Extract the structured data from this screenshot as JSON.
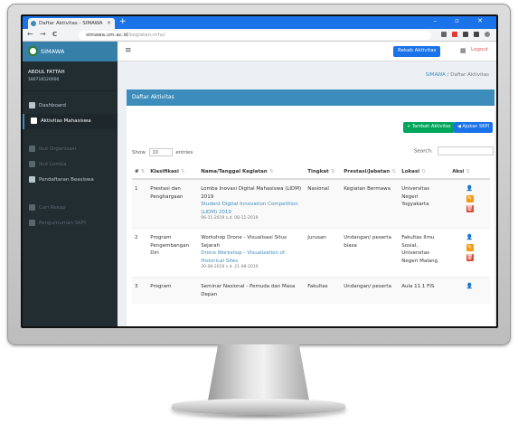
{
  "browser": {
    "tab_title": "Daftar Aktivitas - SIMAWA",
    "tab_close": "×",
    "new_tab": "+",
    "url_host": "simawa.um.ac.id",
    "url_path": "/kegiatan-mhs/",
    "window_controls": "– ▫ ✕",
    "nav_back": "←",
    "nav_forward": "→",
    "nav_reload": "C"
  },
  "sidebar": {
    "brand": "SIMAWA",
    "user_name": "ABDUL FATTAH",
    "user_sub": "180716520000",
    "items": [
      {
        "label": "Dashboard"
      },
      {
        "label": "Aktivitas Mahasiswa"
      },
      {
        "label": "Ikut Organisasi"
      },
      {
        "label": "Ikut Lomba"
      },
      {
        "label": "Pendaftaran Beasiswa"
      },
      {
        "label": "Cari Rekap"
      },
      {
        "label": "Pengumuman SKPI"
      }
    ]
  },
  "topbar": {
    "menu_icon": "≡",
    "rekap_button": "Rekab Aktivitas",
    "grid_icon": "▦",
    "logout": "Logout"
  },
  "breadcrumb": {
    "home": "SIMAWA",
    "sep": " / ",
    "current": "Daftar Aktivitas"
  },
  "box": {
    "title": "Daftar Aktivitas",
    "add_button": "+ Tambah Aktivitas",
    "skpi_button": "◀ Ajukan SKPI",
    "show_label": "Show",
    "show_value": "10",
    "entries_label": "entries",
    "search_label": "Search:"
  },
  "table": {
    "headers": [
      "#",
      "Klasifikasi",
      "Nama/Tanggal Kegiatan",
      "Tingkat",
      "Prestasi/Jabatan",
      "Lokasi",
      "Aksi"
    ],
    "rows": [
      {
        "no": "1",
        "klasifikasi": "Prestasi dan Penghargaan",
        "nama": "Lomba Inovasi Digital Mahasiswa (LIDM) 2019",
        "nama_en": "Student Digital Innovation Competition (LIDM) 2019",
        "tanggal": "06-11-2019 s.d. 08-11-2019",
        "tingkat": "Nasional",
        "prestasi": "Kegiatan Bermawa",
        "lokasi": "Universitas Negeri Yogyakarta"
      },
      {
        "no": "2",
        "klasifikasi": "Program Pengembangan Diri",
        "nama": "Workshop Drone - Visualisasi Situs Sejarah",
        "nama_en": "Drone Workshop - Visualization of Historical Sites",
        "tanggal": "20-08-2019 s.d. 21-08-2019",
        "tingkat": "Jurusan",
        "prestasi": "Undangan/ peserta biasa",
        "lokasi": "Fakultas Ilmu Sosial, Universitas Negeri Malang"
      },
      {
        "no": "3",
        "klasifikasi": "Program",
        "nama": "Seminar Nasional - Pemuda dan Masa Depan",
        "nama_en": "",
        "tanggal": "",
        "tingkat": "Fakultas",
        "prestasi": "Undangan/ peserta",
        "lokasi": "Aula 11.1 FIS"
      }
    ]
  },
  "icons": {
    "user": "👤",
    "edit": "✎",
    "delete": "🗑"
  },
  "colors": {
    "primary": "#3c8dbc",
    "success": "#00a65a",
    "warning": "#f39c12",
    "danger": "#dd4b39",
    "sidebar": "#222d32"
  }
}
